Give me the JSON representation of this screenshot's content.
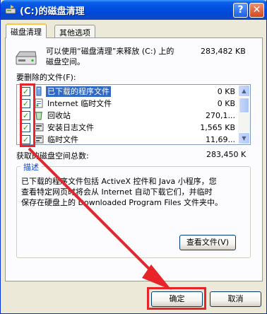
{
  "window": {
    "title": "(C:)的磁盘清理",
    "help_label": "?",
    "close_label": "✕"
  },
  "tabs": [
    {
      "label": "磁盘清理",
      "active": true
    },
    {
      "label": "其他选项",
      "active": false
    }
  ],
  "intro": {
    "line1": "可以使用“磁盘清理”来释放 (C:) 上的",
    "size": "283,482 KB",
    "line2": "磁盘空间。"
  },
  "files": {
    "label": "要删除的文件(F):",
    "items": [
      {
        "name": "已下载的程序文件",
        "size": "0 KB",
        "checked": true,
        "selected": true,
        "icon": "folder-icon"
      },
      {
        "name": "Internet 临时文件",
        "size": "0 KB",
        "checked": true,
        "selected": false,
        "icon": "document-icon"
      },
      {
        "name": "回收站",
        "size": "270,1...",
        "checked": true,
        "selected": false,
        "icon": "recycle-bin-icon"
      },
      {
        "name": "安装日志文件",
        "size": "1,565 KB",
        "checked": true,
        "selected": false,
        "icon": "setup-log-icon"
      },
      {
        "name": "临时文件",
        "size": "11,69...",
        "checked": true,
        "selected": false,
        "icon": "temp-file-icon"
      }
    ]
  },
  "total": {
    "label": "获取的磁盘空间总数:",
    "value": "283,450 K"
  },
  "description": {
    "title": "描述",
    "lines": [
      "已下载的程序文件包括 ActiveX 控件和 Java 小程序，您",
      "查看特定网页时将会从 Internet 自动下载它们，并临时",
      "保存在硬盘上的 Downloaded Program Files 文件夹中。"
    ]
  },
  "buttons": {
    "view_files": "查看文件(V)",
    "ok": "确定",
    "cancel": "取消"
  },
  "colors": {
    "annotation_red": "#e8232a",
    "selection_blue": "#316ac5"
  }
}
